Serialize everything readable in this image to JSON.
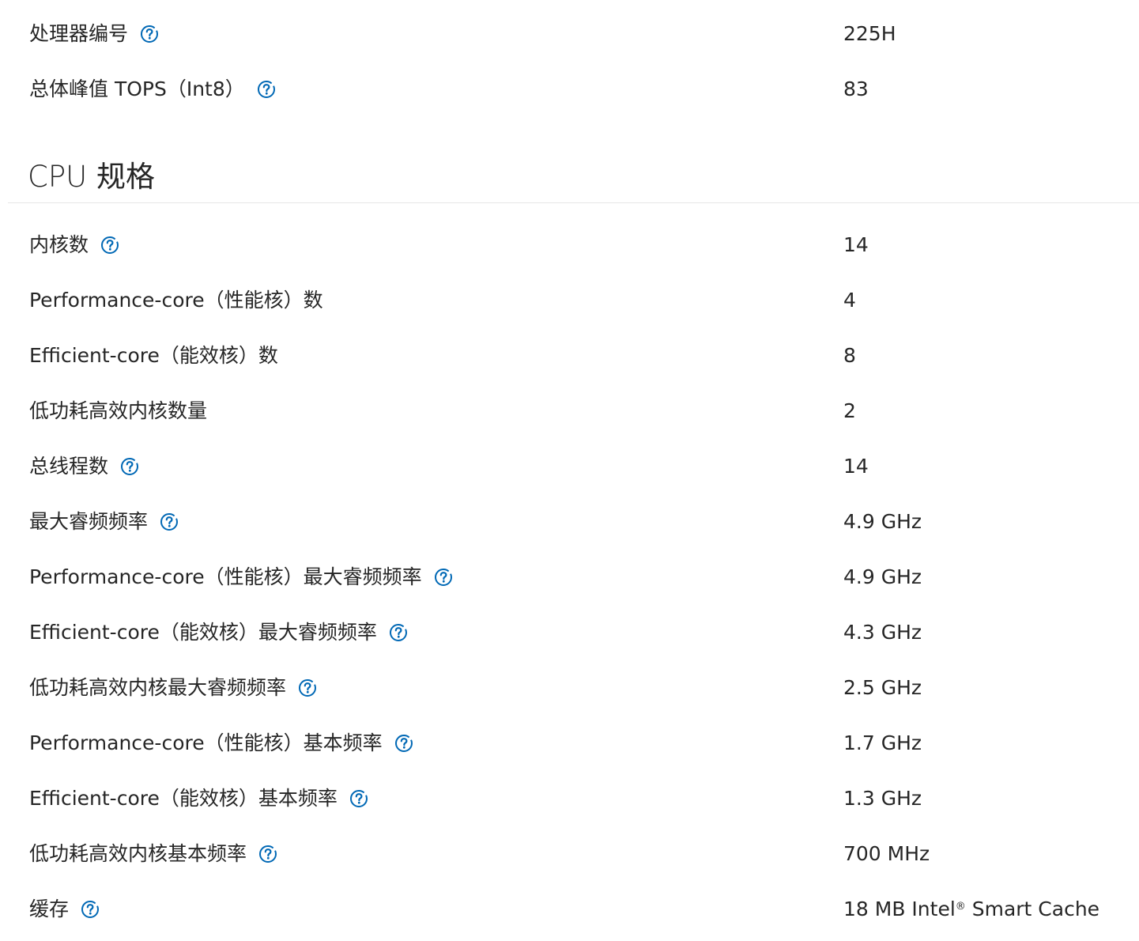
{
  "top_specs": [
    {
      "label": "处理器编号",
      "value": "225H",
      "help": true
    },
    {
      "label": "总体峰值 TOPS（Int8）",
      "value": "83",
      "help": true
    }
  ],
  "cpu_section": {
    "title": "CPU 规格",
    "rows": [
      {
        "label": "内核数",
        "value": "14",
        "help": true
      },
      {
        "label": "Performance-core（性能核）数",
        "value": "4",
        "help": false
      },
      {
        "label": "Efficient-core（能效核）数",
        "value": "8",
        "help": false
      },
      {
        "label": "低功耗高效内核数量",
        "value": "2",
        "help": false
      },
      {
        "label": "总线程数",
        "value": "14",
        "help": true
      },
      {
        "label": "最大睿频频率",
        "value": "4.9 GHz",
        "help": true
      },
      {
        "label": "Performance-core（性能核）最大睿频频率",
        "value": "4.9 GHz",
        "help": true
      },
      {
        "label": "Efficient-core（能效核）最大睿频频率",
        "value": "4.3 GHz",
        "help": true
      },
      {
        "label": "低功耗高效内核最大睿频频率",
        "value": "2.5 GHz",
        "help": true
      },
      {
        "label": "Performance-core（性能核）基本频率",
        "value": "1.7 GHz",
        "help": true
      },
      {
        "label": "Efficient-core（能效核）基本频率",
        "value": "1.3 GHz",
        "help": true
      },
      {
        "label": "低功耗高效内核基本频率",
        "value": "700 MHz",
        "help": true
      },
      {
        "label": "缓存",
        "value_prefix": "18 MB Intel",
        "value_sup": "®",
        "value_suffix": " Smart Cache",
        "help": true
      }
    ]
  },
  "colors": {
    "text": "#262626",
    "help_icon": "#0068b5",
    "divider": "#e6e6e6"
  },
  "icons": {
    "help": "question-circle-icon"
  }
}
